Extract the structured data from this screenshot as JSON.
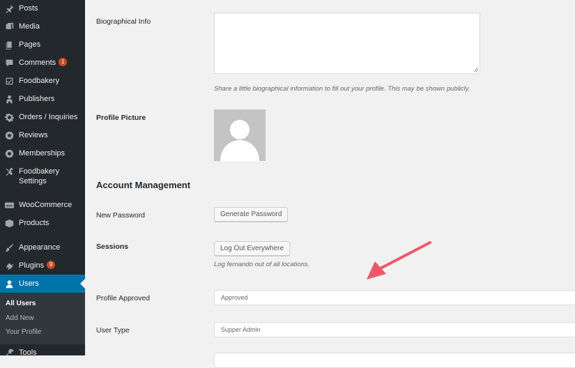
{
  "sidebar": {
    "items": [
      {
        "label": "Posts",
        "icon": "pin-icon"
      },
      {
        "label": "Media",
        "icon": "media-icon"
      },
      {
        "label": "Pages",
        "icon": "pages-icon"
      },
      {
        "label": "Comments",
        "icon": "comment-icon",
        "badge": "1"
      },
      {
        "label": "Foodbakery",
        "icon": "checkbox-icon"
      },
      {
        "label": "Publishers",
        "icon": "publisher-icon"
      },
      {
        "label": "Orders / Inquiries",
        "icon": "gear-icon"
      },
      {
        "label": "Reviews",
        "icon": "star-icon"
      },
      {
        "label": "Memberships",
        "icon": "gear-icon"
      },
      {
        "label": "Foodbakery",
        "label2": "Settings",
        "icon": "tools-icon"
      },
      {
        "label": "WooCommerce",
        "icon": "woo-icon"
      },
      {
        "label": "Products",
        "icon": "box-icon"
      },
      {
        "label": "Appearance",
        "icon": "brush-icon"
      },
      {
        "label": "Plugins",
        "icon": "plugin-icon",
        "badge": "9"
      },
      {
        "label": "Users",
        "icon": "user-icon"
      },
      {
        "label": "Tools",
        "icon": "wrench-icon"
      }
    ],
    "submenu": [
      "All Users",
      "Add New",
      "Your Profile"
    ]
  },
  "main": {
    "bio_label": "Biographical Info",
    "bio_description": "Share a little biographical information to fill out your profile. This may be shown publicly.",
    "picture_label": "Profile Picture",
    "section_title": "Account Management",
    "new_password_label": "New Password",
    "generate_password_button": "Generate Password",
    "sessions_label": "Sessions",
    "logout_button": "Log Out Everywhere",
    "logout_description": "Log fernando out of all locations.",
    "profile_approved_label": "Profile Approved",
    "profile_approved_value": "Approved",
    "user_type_label": "User Type",
    "user_type_value": "Supper Admin"
  },
  "colors": {
    "sidebar_bg": "#23282d",
    "active_item": "#0073aa",
    "badge": "#ca4a1f",
    "annotation_arrow": "#f0566a"
  }
}
